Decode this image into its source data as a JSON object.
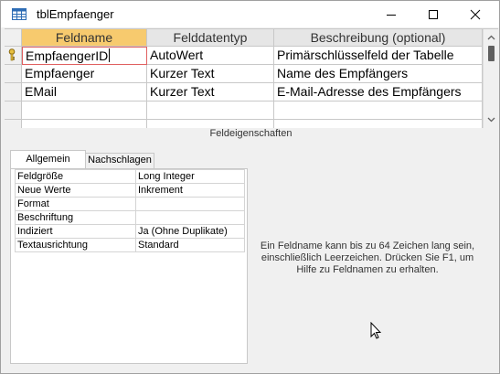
{
  "window": {
    "title": "tblEmpfaenger"
  },
  "grid": {
    "headers": [
      "Feldname",
      "Felddatentyp",
      "Beschreibung (optional)"
    ],
    "rows": [
      {
        "name": "EmpfaengerID",
        "type": "AutoWert",
        "desc": "Primärschlüsselfeld der Tabelle",
        "primary_key": true
      },
      {
        "name": "Empfaenger",
        "type": "Kurzer Text",
        "desc": "Name des Empfängers"
      },
      {
        "name": "EMail",
        "type": "Kurzer Text",
        "desc": "E-Mail-Adresse des Empfängers"
      }
    ]
  },
  "properties": {
    "section_label": "Feldeigenschaften",
    "tabs": [
      "Allgemein",
      "Nachschlagen"
    ],
    "rows": [
      {
        "name": "Feldgröße",
        "value": "Long Integer"
      },
      {
        "name": "Neue Werte",
        "value": "Inkrement"
      },
      {
        "name": "Format",
        "value": ""
      },
      {
        "name": "Beschriftung",
        "value": ""
      },
      {
        "name": "Indiziert",
        "value": "Ja (Ohne Duplikate)"
      },
      {
        "name": "Textausrichtung",
        "value": "Standard"
      }
    ],
    "help_text": "Ein Feldname kann bis zu 64 Zeichen lang sein, einschließlich Leerzeichen. Drücken Sie F1, um Hilfe zu Feldnamen zu erhalten."
  },
  "icons": [
    "table-icon",
    "minimize-icon",
    "maximize-icon",
    "close-icon",
    "primary-key-icon",
    "mouse-cursor-icon"
  ]
}
